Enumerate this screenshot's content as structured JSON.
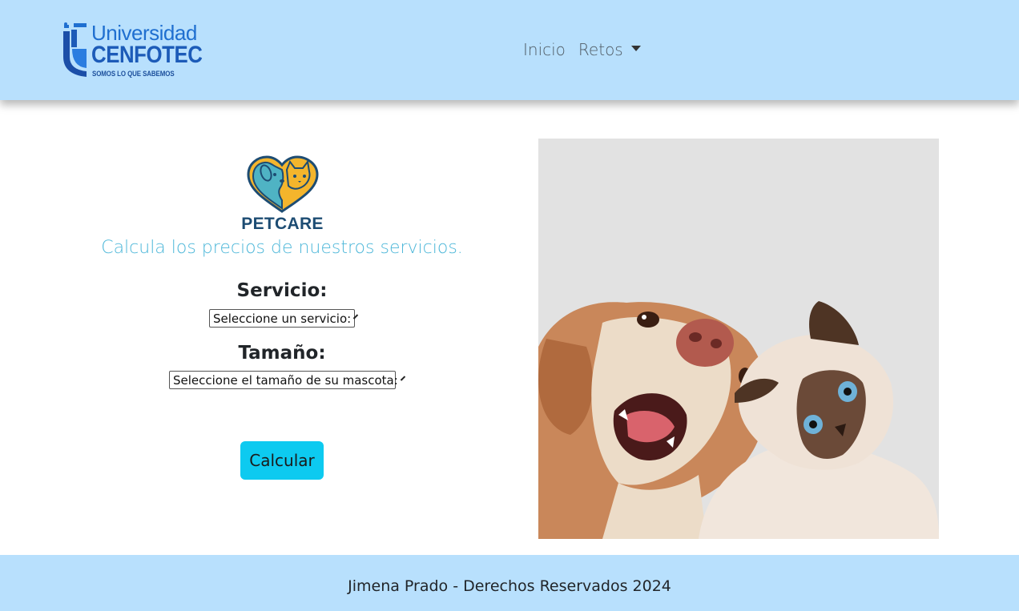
{
  "header": {
    "logo": {
      "line1": "Universidad",
      "line2": "CENFOTEC",
      "tagline": "SOMOS LO QUE SABEMOS",
      "icon": "cenfotec-logo-icon"
    },
    "nav": {
      "items": [
        {
          "label": "Inicio"
        },
        {
          "label": "Retos"
        }
      ]
    }
  },
  "main": {
    "brand": "PETCARE",
    "brand_icon": "heart-dog-cat-icon",
    "subtitle": "Calcula los precios de nuestros servicios.",
    "service_label": "Servicio:",
    "service_select": "Seleccione un servicio:",
    "size_label": "Tamaño:",
    "size_select": "Seleccione el tamaño de su mascota:",
    "calc_button": "Calcular",
    "hero_image": "dog-and-cat-photo"
  },
  "footer": {
    "text": "Jimena Prado - Derechos Reservados 2024"
  },
  "colors": {
    "header_bg": "#b8e0fd",
    "accent_button": "#0dcaf0",
    "subtitle": "#4db7d9",
    "brand_navy": "#1d4c73"
  }
}
